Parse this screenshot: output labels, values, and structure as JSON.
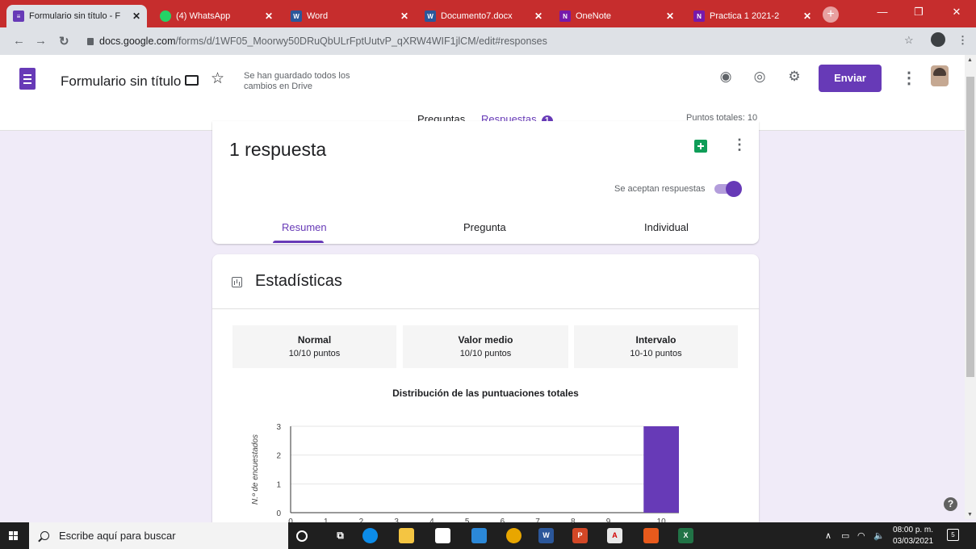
{
  "browser": {
    "tabs": [
      {
        "title": "Formulario sin título - F",
        "icon": "forms-icon"
      },
      {
        "title": "(4) WhatsApp",
        "icon": "whatsapp-icon"
      },
      {
        "title": "Word",
        "icon": "word-icon"
      },
      {
        "title": "Documento7.docx",
        "icon": "word-icon"
      },
      {
        "title": "OneNote",
        "icon": "onenote-icon"
      },
      {
        "title": "Practica 1 2021-2",
        "icon": "onenote-icon"
      }
    ],
    "url_host": "docs.google.com",
    "url_path": "/forms/d/1WF05_Moorwy50DRuQbULrFptUutvP_qXRW4WIF1jlCM/edit#responses"
  },
  "header": {
    "title": "Formulario sin título",
    "saved_status": "Se han guardado todos los cambios en Drive",
    "send_label": "Enviar",
    "tabs": {
      "questions": "Preguntas",
      "responses": "Respuestas",
      "responses_badge": "1"
    },
    "total_points": "Puntos totales: 10"
  },
  "summary": {
    "count_label": "1 respuesta",
    "accepting_label": "Se aceptan respuestas",
    "accepting": true,
    "subtabs": {
      "summary": "Resumen",
      "question": "Pregunta",
      "individual": "Individual"
    }
  },
  "stats": {
    "title": "Estadísticas",
    "boxes": [
      {
        "label": "Normal",
        "value": "10/10 puntos"
      },
      {
        "label": "Valor medio",
        "value": "10/10 puntos"
      },
      {
        "label": "Intervalo",
        "value": "10-10 puntos"
      }
    ]
  },
  "chart_data": {
    "type": "bar",
    "title": "Distribución de las puntuaciones totales",
    "ylabel": "N.º de encuestados",
    "xlabel": "",
    "categories": [
      "0",
      "1",
      "2",
      "3",
      "4",
      "5",
      "6",
      "7",
      "8",
      "9",
      "10"
    ],
    "values": [
      0,
      0,
      0,
      0,
      0,
      0,
      0,
      0,
      0,
      0,
      3
    ],
    "ylim": [
      0,
      3
    ],
    "yticks": [
      "0",
      "1",
      "2",
      "3"
    ],
    "color": "#673ab7",
    "grid": true
  },
  "taskbar": {
    "search_placeholder": "Escribe aquí para buscar",
    "time": "08:00 p. m.",
    "date": "03/03/2021",
    "notifications": "5"
  },
  "colors": {
    "accent": "#673ab7",
    "background": "#f0ebf8",
    "tabstrip": "#c62d2d"
  }
}
